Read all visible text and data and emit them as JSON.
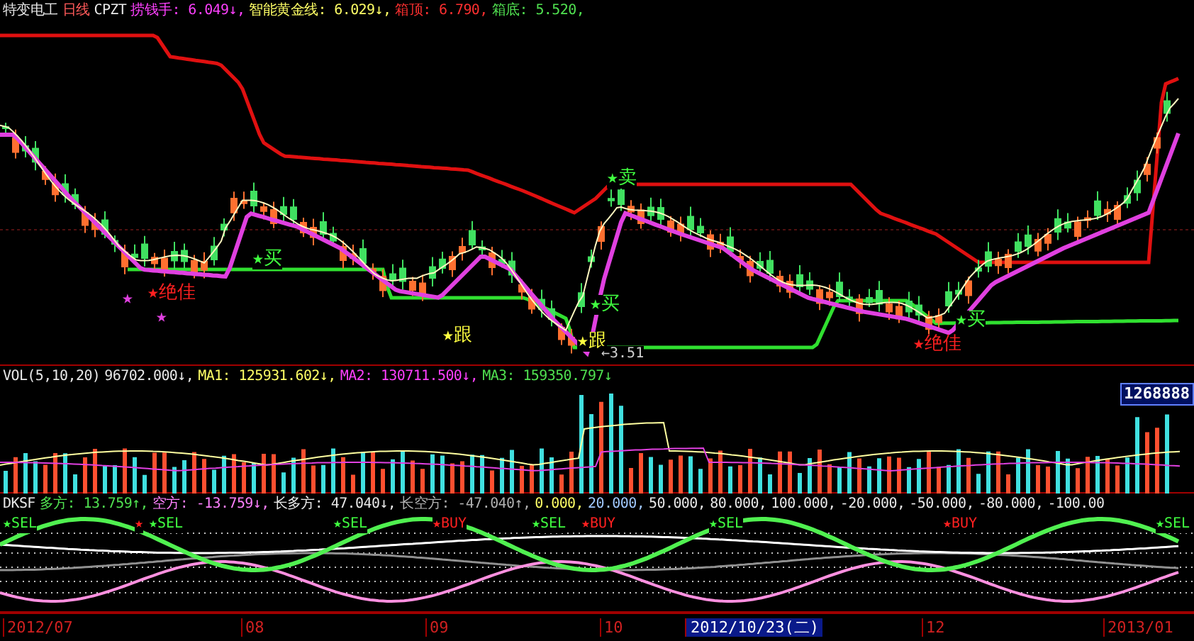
{
  "main": {
    "header": [
      {
        "text": "特变电工",
        "color": "#e8e8e8"
      },
      {
        "text": "日线",
        "color": "#ff5a5a"
      },
      {
        "text": "CPZT",
        "color": "#e8e8e8"
      },
      {
        "text": "捞钱手: 6.049↓,",
        "color": "#ff40ff"
      },
      {
        "text": "智能黄金线: 6.029↓,",
        "color": "#ffff66"
      },
      {
        "text": "箱顶: 6.790,",
        "color": "#ff3030"
      },
      {
        "text": "箱底: 5.520,",
        "color": "#50e050"
      }
    ],
    "markers": [
      {
        "label": "★",
        "kind": "alt"
      },
      {
        "label": "★",
        "kind": "alt"
      },
      {
        "label": "★绝佳",
        "kind": "best"
      },
      {
        "label": "★买",
        "kind": "buy"
      },
      {
        "label": "★跟",
        "kind": "follow"
      },
      {
        "label": "★卖",
        "kind": "sell"
      },
      {
        "label": "★买",
        "kind": "buy"
      },
      {
        "label": "★跟",
        "kind": "follow"
      },
      {
        "label": "★买",
        "kind": "buy"
      },
      {
        "label": "★绝佳",
        "kind": "best"
      }
    ],
    "low_label": "←3.51"
  },
  "volume": {
    "header": [
      {
        "text": "VOL(5,10,20)",
        "color": "#e8e8e8"
      },
      {
        "text": "96702.000↓,",
        "color": "#e8e8e8"
      },
      {
        "text": "MA1: 125931.602↓,",
        "color": "#ffff66"
      },
      {
        "text": "MA2: 130711.500↓,",
        "color": "#ff40ff"
      },
      {
        "text": "MA3: 159350.797↓",
        "color": "#50e050"
      }
    ],
    "scale_label": "1268888"
  },
  "dksf": {
    "header": [
      {
        "text": "DKSF",
        "color": "#e8e8e8"
      },
      {
        "text": "多方: 13.759↑,",
        "color": "#50e050"
      },
      {
        "text": "空方: -13.759↓,",
        "color": "#ff80ff"
      },
      {
        "text": "长多方: 47.040↓,",
        "color": "#e8e8e8"
      },
      {
        "text": "长空方: -47.040↑,",
        "color": "#b0b0b0"
      },
      {
        "text": "0.000,",
        "color": "#ffff66"
      },
      {
        "text": "20.000,",
        "color": "#a0c8ff"
      },
      {
        "text": "50.000,",
        "color": "#e8e8e8"
      },
      {
        "text": "80.000,",
        "color": "#e8e8e8"
      },
      {
        "text": "100.000,",
        "color": "#e8e8e8"
      },
      {
        "text": "-20.000,",
        "color": "#e8e8e8"
      },
      {
        "text": "-50.000,",
        "color": "#e8e8e8"
      },
      {
        "text": "-80.000,",
        "color": "#e8e8e8"
      },
      {
        "text": "-100.00",
        "color": "#e8e8e8"
      }
    ],
    "signals": [
      {
        "label": "★SEL",
        "kind": "sel"
      },
      {
        "label": "★",
        "kind": "buy"
      },
      {
        "label": "★SEL",
        "kind": "sel"
      },
      {
        "label": "★SEL",
        "kind": "sel"
      },
      {
        "label": "★BUY",
        "kind": "buy"
      },
      {
        "label": "★SEL",
        "kind": "sel"
      },
      {
        "label": "★BUY",
        "kind": "buy"
      },
      {
        "label": "★SEL",
        "kind": "sel"
      },
      {
        "label": "★BUY",
        "kind": "buy"
      },
      {
        "label": "★SEL",
        "kind": "sel"
      }
    ]
  },
  "time_axis": [
    {
      "label": "2012/07",
      "selected": false
    },
    {
      "label": "08",
      "selected": false
    },
    {
      "label": "09",
      "selected": false
    },
    {
      "label": "10",
      "selected": false
    },
    {
      "label": "2012/10/23(二)",
      "selected": true
    },
    {
      "label": "12",
      "selected": false
    },
    {
      "label": "2013/01",
      "selected": false
    }
  ]
}
